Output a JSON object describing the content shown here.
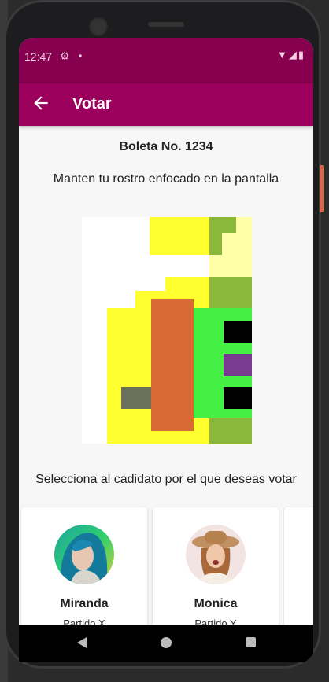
{
  "status": {
    "time": "12:47",
    "settings_icon": "gear-icon",
    "notification_dot": "•",
    "indicators": "▼◢▮"
  },
  "appbar": {
    "title": "Votar",
    "back_icon": "arrow-left-icon"
  },
  "ballot": {
    "label": "Boleta No. 1234"
  },
  "camera": {
    "instruction": "Manten tu rostro enfocado en la pantalla"
  },
  "candidates": {
    "prompt": "Selecciona al cadidato por el que deseas votar",
    "items": [
      {
        "name": "Miranda",
        "party": "Partido X"
      },
      {
        "name": "Monica",
        "party": "Partido Y"
      }
    ]
  },
  "colors": {
    "status_bar": "#86004f",
    "app_bar": "#9c005d",
    "background": "#f7f7f7"
  }
}
